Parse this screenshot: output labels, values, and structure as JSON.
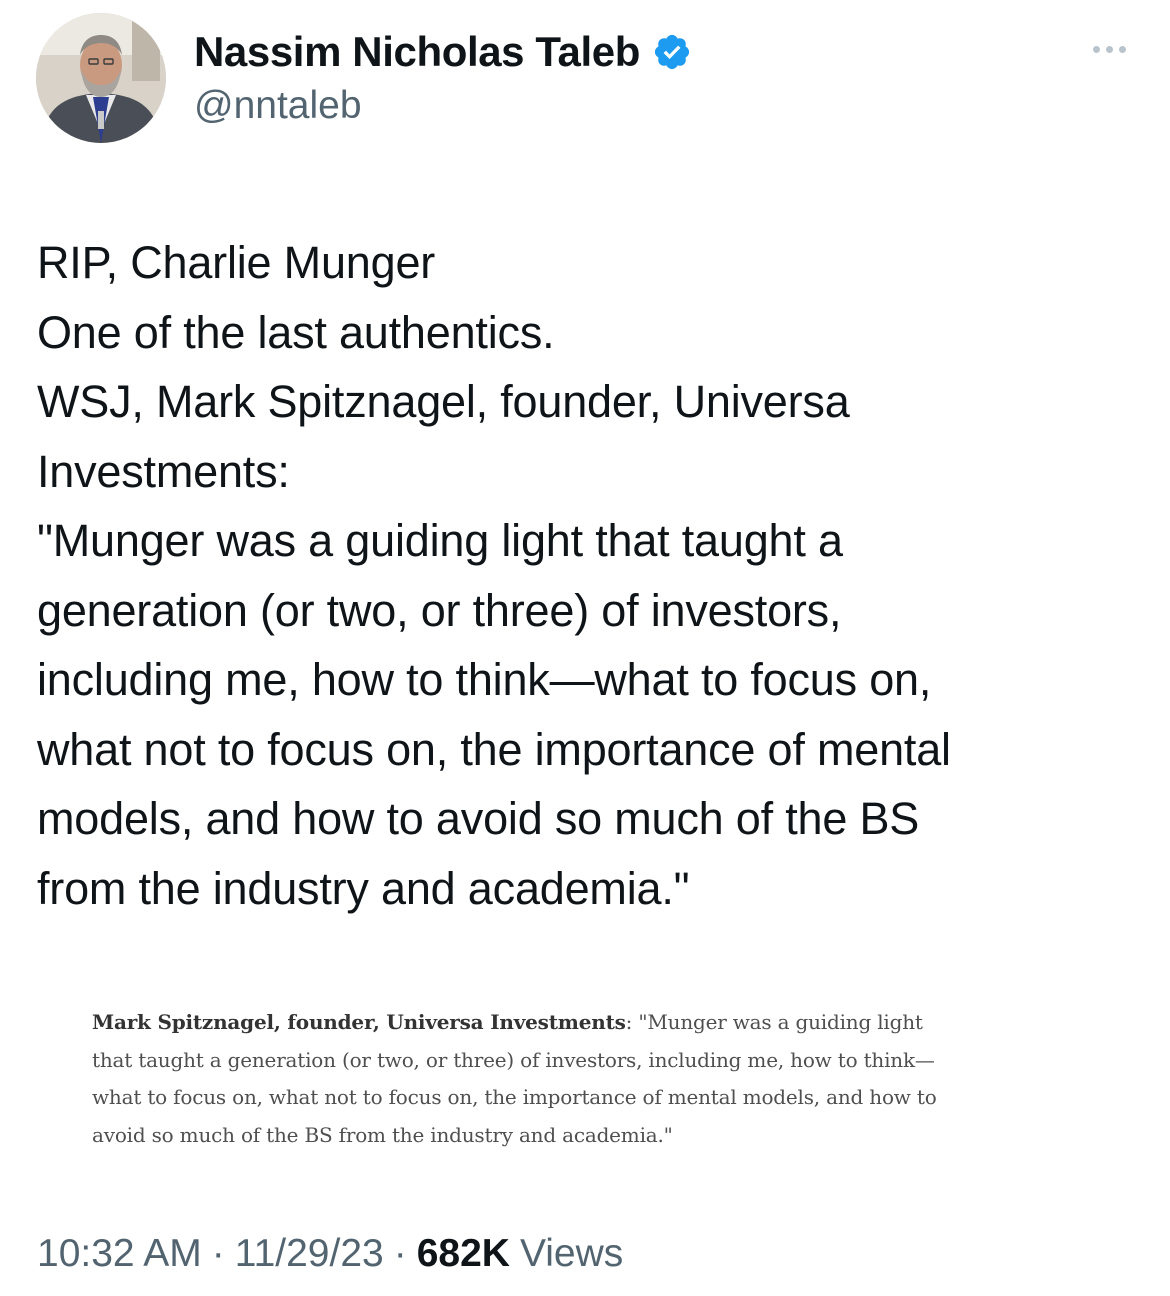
{
  "author": {
    "display_name": "Nassim Nicholas Taleb",
    "handle": "@nntaleb",
    "verified_icon": "verified-badge-icon",
    "verified_color": "#1d9bf0"
  },
  "more_icon": "more-horizontal-icon",
  "tweet": {
    "lines": [
      "RIP, Charlie Munger",
      "One of the last authentics.",
      "WSJ, Mark Spitznagel, founder, Universa",
      "Investments:",
      "\"Munger was a guiding light that taught a",
      "generation (or two, or three) of investors,",
      "including me, how to think—what to focus on,",
      "what not to focus on, the importance of mental",
      "models, and how to avoid so much of the BS",
      "from the industry and academia.\""
    ]
  },
  "attached_image": {
    "speaker": "Mark Spitznagel, founder, Universa Investments",
    "line1_rest": ": \"Munger was a guiding light",
    "line2": "that taught a generation (or two, or three) of investors, including me, how to think—",
    "line3": "what to focus on, what not to focus on, the importance of mental models, and how to",
    "line4": "avoid so much of the BS from the industry and academia.\""
  },
  "meta": {
    "time": "10:32 AM",
    "separator": "·",
    "date": "11/29/23",
    "views_count": "682K",
    "views_label": "Views"
  },
  "colors": {
    "text_primary": "#0f1419",
    "text_secondary": "#536471",
    "accent": "#1d9bf0"
  }
}
